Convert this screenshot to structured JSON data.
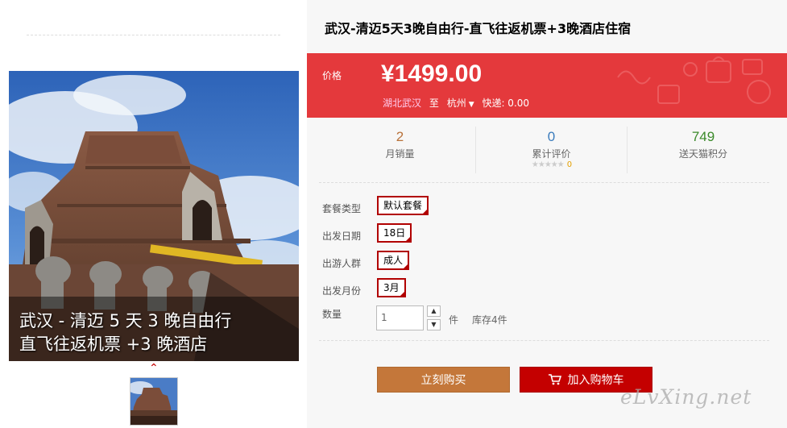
{
  "gallery": {
    "caption_line1": "武汉 - 清迈 5 天 3 晚自由行",
    "caption_line2": "直飞往返机票 +3 晚酒店",
    "thumb_up": "⌃"
  },
  "product": {
    "title": "武汉-清迈5天3晚自由行-直飞往返机票+3晚酒店住宿"
  },
  "price": {
    "label": "价格",
    "value": "¥1499.00",
    "from": "湖北武汉",
    "to_word": "至",
    "to_city": "杭州",
    "caret": "▼",
    "shipping": "快递: 0.00"
  },
  "stats": {
    "monthly_sales_num": "2",
    "monthly_sales_label": "月销量",
    "reviews_num": "0",
    "reviews_label": "累计评价",
    "review_stars": "★★★★★",
    "review_score": "0",
    "points_num": "749",
    "points_label": "送天猫积分"
  },
  "colors": {
    "price_bg": "#e4393c",
    "sales_num": "#b9723a",
    "reviews_num": "#3b7cbc",
    "points_num": "#3b8a2a",
    "option_border": "#b10000",
    "buy_button": "#c4773a",
    "cart_button": "#c40000"
  },
  "options": {
    "package_label": "套餐类型",
    "package_value": "默认套餐",
    "date_label": "出发日期",
    "date_value": "18日",
    "group_label": "出游人群",
    "group_value": "成人",
    "month_label": "出发月份",
    "month_value": "3月",
    "quantity_label": "数量",
    "quantity_value": "1",
    "quantity_unit": "件",
    "stock": "库存4件"
  },
  "actions": {
    "buy_now": "立刻购买",
    "add_to_cart": "加入购物车"
  },
  "watermark": "eLvXing.net"
}
